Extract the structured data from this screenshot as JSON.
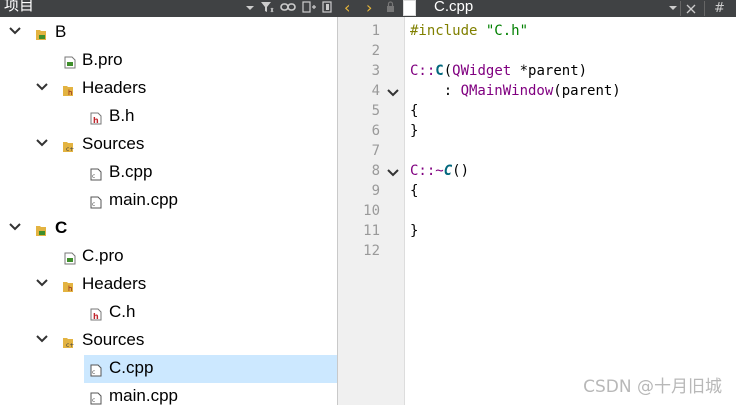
{
  "project_panel": {
    "title": "项目",
    "tree": [
      {
        "label": "B",
        "bold": false,
        "expanded": true,
        "icon": "project-icon"
      },
      {
        "label": "B.pro",
        "icon": "pro-file-icon"
      },
      {
        "label": "Headers",
        "expanded": true,
        "icon": "headers-folder-icon"
      },
      {
        "label": "B.h",
        "icon": "header-file-icon"
      },
      {
        "label": "Sources",
        "expanded": true,
        "icon": "sources-folder-icon"
      },
      {
        "label": "B.cpp",
        "icon": "cpp-file-icon"
      },
      {
        "label": "main.cpp",
        "icon": "cpp-file-icon"
      },
      {
        "label": "C",
        "bold": true,
        "expanded": true,
        "icon": "project-icon"
      },
      {
        "label": "C.pro",
        "icon": "pro-file-icon"
      },
      {
        "label": "Headers",
        "expanded": true,
        "icon": "headers-folder-icon"
      },
      {
        "label": "C.h",
        "icon": "header-file-icon"
      },
      {
        "label": "Sources",
        "expanded": true,
        "icon": "sources-folder-icon"
      },
      {
        "label": "C.cpp",
        "icon": "cpp-file-icon",
        "selected": true
      },
      {
        "label": "main.cpp",
        "icon": "cpp-file-icon"
      }
    ]
  },
  "editor": {
    "file_name": "C.cpp",
    "line_numbers": [
      "1",
      "2",
      "3",
      "4",
      "5",
      "6",
      "7",
      "8",
      "9",
      "10",
      "11",
      "12"
    ],
    "code": {
      "l1_directive": "#include",
      "l1_string": "\"C.h\"",
      "l3_scope": "C::",
      "l3_fn": "C",
      "l3_open": "(",
      "l3_type": "QWidget",
      "l3_rest": " *parent)",
      "l4_colon": "    : ",
      "l4_base": "QMainWindow",
      "l4_rest": "(parent)",
      "l5": "{",
      "l6": "}",
      "l8_scope": "C::~",
      "l8_fn": "C",
      "l8_rest": "()",
      "l9": "{",
      "l11": "}"
    }
  },
  "watermark": "CSDN @十月旧城",
  "colors": {
    "toolbar_bg": "#404244",
    "selection": "#cce8ff",
    "keyword": "#808000",
    "string": "#008000",
    "class": "#800080",
    "function": "#00677c"
  }
}
